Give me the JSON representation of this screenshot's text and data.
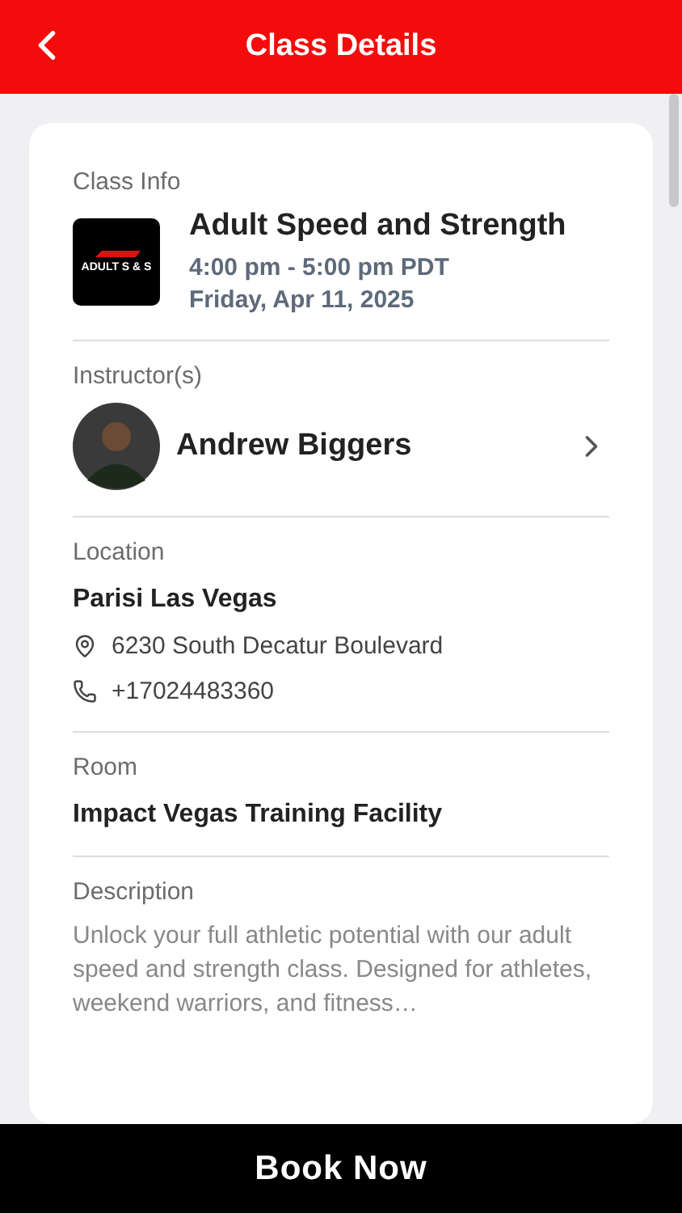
{
  "header": {
    "title": "Class Details"
  },
  "class_info": {
    "label": "Class Info",
    "logo_text": "ADULT S & S",
    "name": "Adult Speed and Strength",
    "time": "4:00 pm - 5:00 pm PDT",
    "date": "Friday, Apr 11, 2025"
  },
  "instructors": {
    "label": "Instructor(s)",
    "items": [
      {
        "name": "Andrew Biggers"
      }
    ]
  },
  "location": {
    "label": "Location",
    "name": "Parisi Las Vegas",
    "address": "6230 South Decatur Boulevard",
    "phone": "+17024483360"
  },
  "room": {
    "label": "Room",
    "name": "Impact Vegas Training Facility"
  },
  "description": {
    "label": "Description",
    "text": "Unlock your full athletic potential with our adult speed and strength class. Designed for athletes, weekend warriors, and fitness…"
  },
  "book_button": "Book Now"
}
